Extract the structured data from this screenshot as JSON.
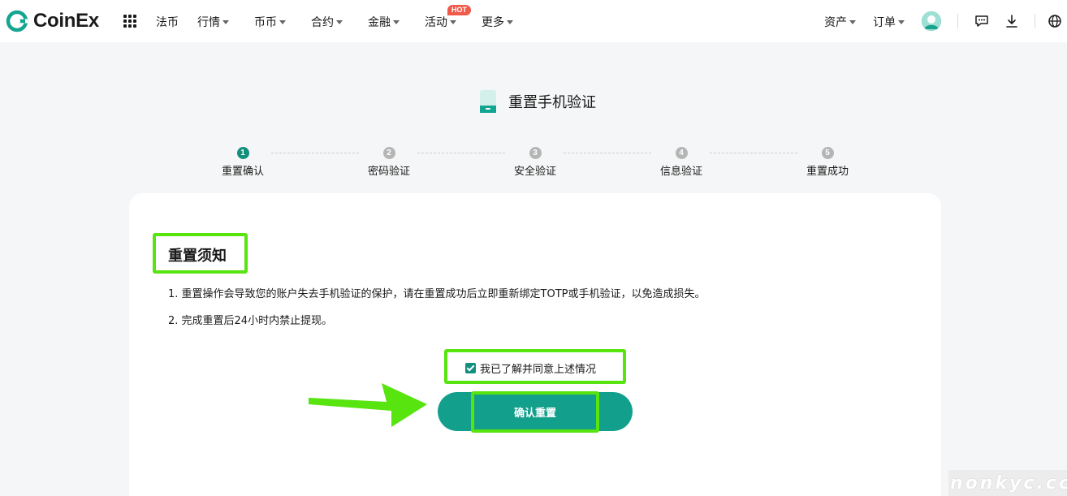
{
  "header": {
    "logo_text": "CoinEx",
    "nav": [
      {
        "label": "法币",
        "dropdown": false
      },
      {
        "label": "行情",
        "dropdown": true
      },
      {
        "label": "币币",
        "dropdown": true
      },
      {
        "label": "合约",
        "dropdown": true
      },
      {
        "label": "金融",
        "dropdown": true
      },
      {
        "label": "活动",
        "dropdown": true
      },
      {
        "label": "更多",
        "dropdown": true
      }
    ],
    "hot_badge": "HOT",
    "right": [
      {
        "label": "资产",
        "dropdown": true
      },
      {
        "label": "订单",
        "dropdown": true
      }
    ],
    "icons": [
      "apps-grid-icon",
      "avatar-icon",
      "message-icon",
      "download-icon",
      "globe-icon"
    ]
  },
  "page": {
    "title": "重置手机验证",
    "title_icon": "phone-icon"
  },
  "steps": [
    {
      "num": "1",
      "label": "重置确认",
      "active": true
    },
    {
      "num": "2",
      "label": "密码验证",
      "active": false
    },
    {
      "num": "3",
      "label": "安全验证",
      "active": false
    },
    {
      "num": "4",
      "label": "信息验证",
      "active": false
    },
    {
      "num": "5",
      "label": "重置成功",
      "active": false
    }
  ],
  "notice": {
    "title": "重置须知",
    "lines": [
      "1. 重置操作会导致您的账户失去手机验证的保护，请在重置成功后立即重新绑定TOTP或手机验证，以免造成损失。",
      "2. 完成重置后24小时内禁止提现。"
    ]
  },
  "agree": {
    "label": "我已了解并同意上述情况",
    "checked": true
  },
  "confirm_button": {
    "label": "确认重置"
  },
  "watermark": "nonkyc.cc",
  "colors": {
    "brand": "#12a08c",
    "highlight": "#57e40f",
    "hot": "#f05a4b"
  }
}
